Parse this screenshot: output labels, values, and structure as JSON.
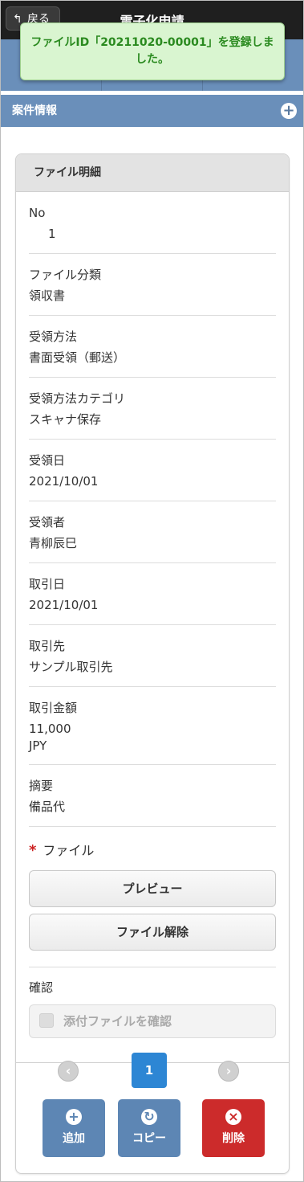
{
  "topbar": {
    "back_label": "戻る",
    "title": "電子化申請"
  },
  "toast": {
    "message": "ファイルID「20211020-00001」を登録しました。"
  },
  "case_bar": {
    "label": "案件情報"
  },
  "card": {
    "header": "ファイル明細",
    "fields": [
      {
        "label": "No",
        "value": "1"
      },
      {
        "label": "ファイル分類",
        "value": "領収書"
      },
      {
        "label": "受領方法",
        "value": "書面受領（郵送）"
      },
      {
        "label": "受領方法カテゴリ",
        "value": "スキャナ保存"
      },
      {
        "label": "受領日",
        "value": "2021/10/01"
      },
      {
        "label": "受領者",
        "value": "青柳辰巳"
      },
      {
        "label": "取引日",
        "value": "2021/10/01"
      },
      {
        "label": "取引先",
        "value": "サンプル取引先"
      },
      {
        "label": "取引金額",
        "value": "11,000",
        "value2": "JPY"
      },
      {
        "label": "摘要",
        "value": "備品代"
      }
    ],
    "file": {
      "required_mark": "*",
      "label": "ファイル",
      "preview_label": "プレビュー",
      "remove_label": "ファイル解除"
    },
    "confirm": {
      "label": "確認",
      "checkbox_label": "添付ファイルを確認"
    },
    "pager": {
      "current": "1"
    },
    "actions": {
      "add": "追加",
      "copy": "コピー",
      "delete": "削除"
    }
  },
  "colors": {
    "header_blue": "#6a8fba",
    "toast_green": "#2a8a1f",
    "pager_blue": "#2d86d4",
    "delete_red": "#cc2b2b"
  }
}
